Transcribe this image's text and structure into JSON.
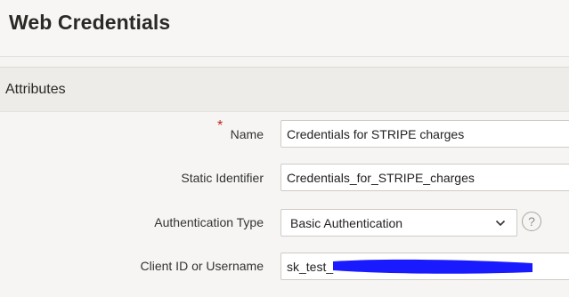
{
  "page": {
    "title": "Web Credentials"
  },
  "region": {
    "title": "Attributes"
  },
  "form": {
    "name": {
      "label": "Name",
      "required_marker": "*",
      "value": "Credentials for STRIPE charges"
    },
    "static_identifier": {
      "label": "Static Identifier",
      "value": "Credentials_for_STRIPE_charges"
    },
    "authentication_type": {
      "label": "Authentication Type",
      "selected": "Basic Authentication",
      "help_label": "?"
    },
    "client_id": {
      "label": "Client ID or Username",
      "value": "sk_test_"
    }
  },
  "colors": {
    "required": "#c0281c",
    "redaction": "#1a1aff"
  },
  "icons": {
    "dropdown": "chevron-down-icon",
    "help": "help-icon"
  }
}
